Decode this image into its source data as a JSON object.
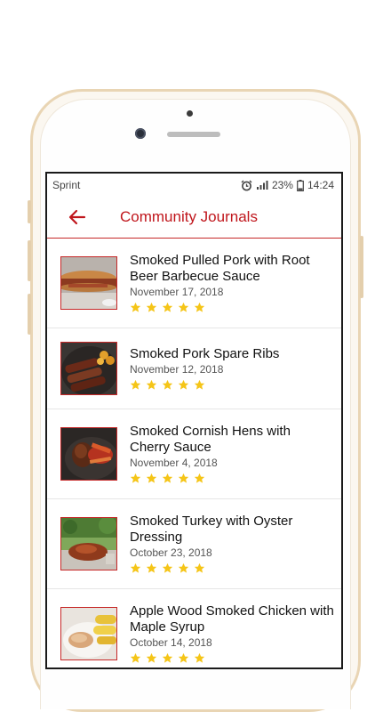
{
  "status": {
    "carrier": "Sprint",
    "battery": "23%",
    "time": "14:24",
    "icons": [
      "alarm-icon",
      "signal-icon",
      "battery-icon"
    ]
  },
  "appbar": {
    "back_icon": "arrow-left-icon",
    "title": "Community Journals",
    "accent": "#c0161c"
  },
  "journals": [
    {
      "title": "Smoked Pulled Pork with Root Beer Barbecue Sauce",
      "date": "November 17, 2018",
      "rating": 5,
      "image": "pulled-pork-sandwich"
    },
    {
      "title": "Smoked Pork Spare Ribs",
      "date": "November 12, 2018",
      "rating": 5,
      "image": "spare-ribs"
    },
    {
      "title": "Smoked Cornish Hens with Cherry Sauce",
      "date": "November 4, 2018",
      "rating": 5,
      "image": "cornish-hens"
    },
    {
      "title": "Smoked Turkey with Oyster Dressing",
      "date": "October 23, 2018",
      "rating": 5,
      "image": "smoked-turkey"
    },
    {
      "title": "Apple Wood Smoked Chicken with Maple Syrup",
      "date": "October 14, 2018",
      "rating": 5,
      "image": "smoked-chicken"
    }
  ],
  "colors": {
    "star": "#f5c518",
    "divider": "#c62828"
  }
}
